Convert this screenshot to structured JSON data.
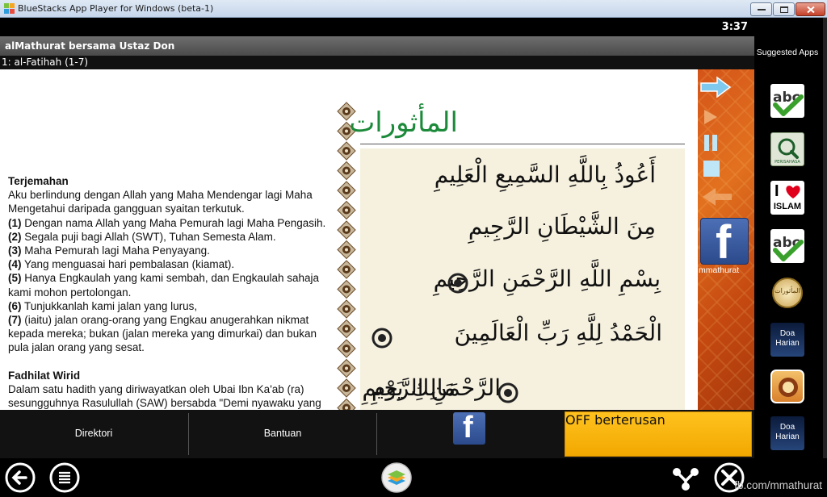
{
  "window": {
    "title": "BlueStacks App Player for Windows (beta-1)"
  },
  "statusbar": {
    "time": "3:37"
  },
  "app": {
    "title": "alMathurat bersama Ustaz Don",
    "chapter": "1: al-Fatihah (1-7)"
  },
  "translation": {
    "heading": "Terjemahan",
    "intro": "Aku berlindung dengan Allah yang Maha Mendengar lagi Maha Mengetahui daripada gangguan syaitan terkutuk.",
    "verses": [
      {
        "num": "(1)",
        "text": " Dengan nama Allah yang Maha Pemurah lagi Maha Pengasih."
      },
      {
        "num": "(2)",
        "text": " Segala puji bagi Allah (SWT), Tuhan Semesta Alam."
      },
      {
        "num": "(3)",
        "text": " Maha Pemurah lagi Maha Penyayang."
      },
      {
        "num": "(4)",
        "text": " Yang menguasai hari pembalasan (kiamat)."
      },
      {
        "num": "(5)",
        "text": " Hanya Engkaulah yang kami sembah, dan Engkaulah sahaja kami mohon pertolongan."
      },
      {
        "num": "(6)",
        "text": " Tunjukkanlah kami jalan yang lurus,"
      },
      {
        "num": "(7)",
        "text": " (iaitu) jalan orang-orang yang Engkau anugerahkan nikmat kepada mereka; bukan (jalan mereka yang dimurkai) dan bukan pula jalan orang yang sesat."
      }
    ],
    "fadhilat_heading": "Fadhilat Wirid",
    "fadhilat_text": "Dalam satu hadith yang diriwayatkan oleh Ubai Ibn Ka'ab (ra) sesungguhnya Rasulullah (SAW) bersabda \"Demi nyawaku yang berada di dalam kekuasaan-Nya, tidak ada satu surah Taurat, dalam Injil, dalam Zabur dan dalam Al - Furqan sepertinya (Al-Fatihah)\""
  },
  "arabic": {
    "header": "المأثورات",
    "lines": [
      "أَعُوذُ بِاللَّهِ السَّمِيعِ الْعَلِيمِ",
      "مِنَ الشَّيْطَانِ الرَّجِيمِ",
      "بِسْمِ اللَّهِ الرَّحْمَنِ الرَّحِيمِ",
      "الْحَمْدُ لِلَّهِ رَبِّ الْعَالَمِينَ",
      "الرَّحْمَنِ الرَّحِيمِ",
      "مَالِكِ يَوْمِ"
    ]
  },
  "controls": {
    "facebook_label": "mmathurat"
  },
  "bottombar": {
    "direktori": "Direktori",
    "bantuan": "Bantuan",
    "off": "OFF berterusan"
  },
  "sidebar": {
    "title": "Suggested Apps",
    "apps": [
      {
        "icon": "abc-check-icon"
      },
      {
        "icon": "perisahasa-search-icon",
        "label": "PERISAHASA"
      },
      {
        "icon": "i-love-islam-icon",
        "line1": "I",
        "line2": "ISLAM"
      },
      {
        "icon": "abc-check-icon"
      },
      {
        "icon": "mathurat-logo-icon",
        "label": "المأثورات"
      },
      {
        "icon": "doa-harian-icon",
        "line1": "Doa",
        "line2": "Harian"
      },
      {
        "icon": "quran-app-icon"
      },
      {
        "icon": "doa-harian-icon",
        "line1": "Doa",
        "line2": "Harian"
      }
    ]
  },
  "watermark": "fb.com/mmathurat",
  "colors": {
    "accent_orange": "#e2711f",
    "button_yellow": "#ffc21e",
    "facebook_blue": "#3b5998",
    "arabic_green": "#1c8a3a"
  }
}
